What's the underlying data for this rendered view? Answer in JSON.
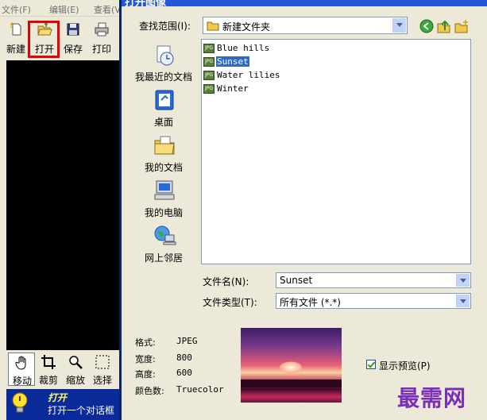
{
  "app": {
    "menu": [
      "文件(F)",
      "编辑(E)",
      "查看(V)"
    ],
    "toolbar": [
      {
        "label": "新建",
        "icon": "new-icon"
      },
      {
        "label": "打开",
        "icon": "open-folder-icon"
      },
      {
        "label": "保存",
        "icon": "save-icon"
      },
      {
        "label": "打印",
        "icon": "print-icon"
      }
    ],
    "highlight_color": "#e60000",
    "tools": [
      {
        "label": "移动",
        "icon": "hand-icon"
      },
      {
        "label": "裁剪",
        "icon": "crop-icon"
      },
      {
        "label": "缩放",
        "icon": "zoom-icon"
      },
      {
        "label": "选择",
        "icon": "select-icon"
      }
    ],
    "status": {
      "title": "打开",
      "desc": "打开一个对话框"
    }
  },
  "dialog": {
    "title": "打开图像",
    "lookin_label": "查找范围(I):",
    "lookin_value": "新建文件夹",
    "places": [
      {
        "label": "我最近的文档",
        "icon": "recent-documents-icon"
      },
      {
        "label": "桌面",
        "icon": "desktop-icon"
      },
      {
        "label": "我的文档",
        "icon": "my-documents-icon"
      },
      {
        "label": "我的电脑",
        "icon": "my-computer-icon"
      },
      {
        "label": "网上邻居",
        "icon": "network-places-icon"
      }
    ],
    "files": [
      {
        "name": "Blue hills",
        "selected": false
      },
      {
        "name": "Sunset",
        "selected": true
      },
      {
        "name": "Water lilies",
        "selected": false
      },
      {
        "name": "Winter",
        "selected": false
      }
    ],
    "filename_label": "文件名(N):",
    "filename_value": "Sunset",
    "filetype_label": "文件类型(T):",
    "filetype_value": "所有文件 (*.*)",
    "info": [
      {
        "key": "格式:",
        "value": "JPEG"
      },
      {
        "key": "宽度:",
        "value": "800"
      },
      {
        "key": "高度:",
        "value": "600"
      },
      {
        "key": "颜色数:",
        "value": "Truecolor"
      }
    ],
    "preview_checkbox_label": "显示预览(P)",
    "preview_checked": true
  },
  "watermark": "最需网"
}
